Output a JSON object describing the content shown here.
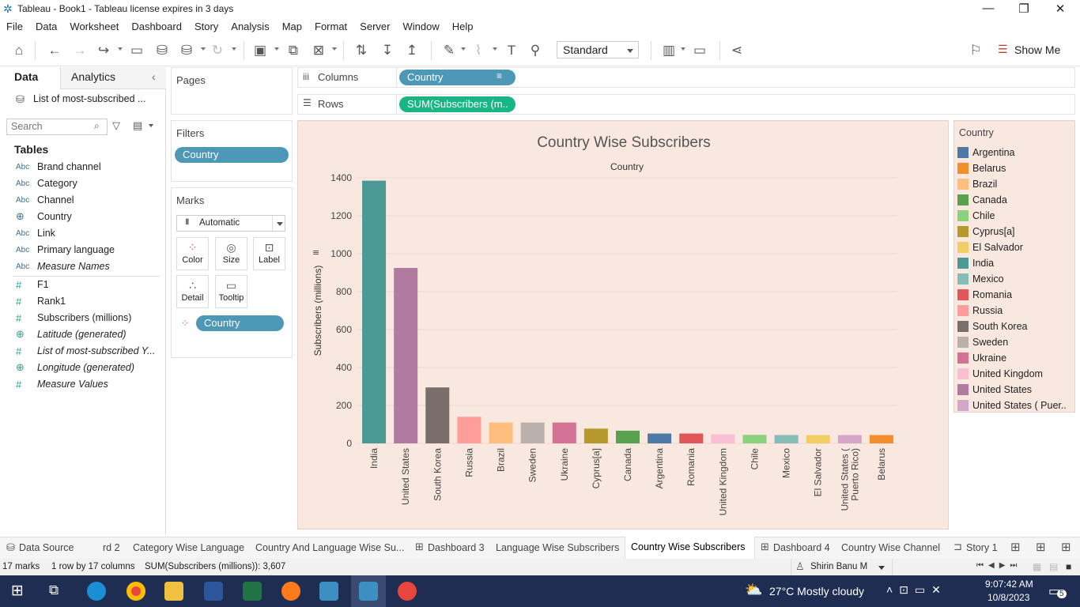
{
  "window": {
    "title": "Tableau - Book1 - Tableau license expires in 3 days"
  },
  "menu": [
    "File",
    "Data",
    "Worksheet",
    "Dashboard",
    "Story",
    "Analysis",
    "Map",
    "Format",
    "Server",
    "Window",
    "Help"
  ],
  "toolbar": {
    "fit_mode": "Standard",
    "show_me": "Show Me"
  },
  "data_pane": {
    "tab_data": "Data",
    "tab_analytics": "Analytics",
    "datasource": "List of most-subscribed ...",
    "search_placeholder": "Search",
    "tables_heading": "Tables",
    "dimensions": [
      {
        "type": "Abc",
        "name": "Brand channel"
      },
      {
        "type": "Abc",
        "name": "Category"
      },
      {
        "type": "Abc",
        "name": "Channel"
      },
      {
        "type": "globe",
        "name": "Country"
      },
      {
        "type": "Abc",
        "name": "Link"
      },
      {
        "type": "Abc",
        "name": "Primary language"
      },
      {
        "type": "Abc",
        "name": "Measure Names"
      }
    ],
    "measures": [
      {
        "type": "#",
        "name": "F1"
      },
      {
        "type": "#",
        "name": "Rank1"
      },
      {
        "type": "#",
        "name": "Subscribers (millions)"
      },
      {
        "type": "globe",
        "name": "Latitude (generated)"
      },
      {
        "type": "#",
        "name": "List of most-subscribed Y..."
      },
      {
        "type": "globe",
        "name": "Longitude (generated)"
      },
      {
        "type": "#",
        "name": "Measure Values"
      }
    ]
  },
  "cards": {
    "pages": "Pages",
    "filters": "Filters",
    "filter_pill": "Country",
    "marks": "Marks",
    "mark_type": "Automatic",
    "mark_buttons": [
      "Color",
      "Size",
      "Label",
      "Detail",
      "Tooltip"
    ],
    "color_pill": "Country"
  },
  "shelves": {
    "columns_label": "Columns",
    "columns_pill": "Country",
    "rows_label": "Rows",
    "rows_pill": "SUM(Subscribers (m.."
  },
  "chart_data": {
    "type": "bar",
    "title": "Country Wise Subscribers",
    "xlabel": "Country",
    "ylabel": "Subscribers (millions)",
    "ylim": [
      0,
      1450
    ],
    "yticks": [
      0,
      200,
      400,
      600,
      800,
      1000,
      1200,
      1400
    ],
    "categories": [
      "India",
      "United States",
      "South Korea",
      "Russia",
      "Brazil",
      "Sweden",
      "Ukraine",
      "Cyprus[a]",
      "Canada",
      "Argentina",
      "Romania",
      "United Kingdom",
      "Chile",
      "Mexico",
      "El Salvador",
      "United States ( Puerto Rico)",
      "Belarus"
    ],
    "category_labels": [
      [
        "India"
      ],
      [
        "United States"
      ],
      [
        "South Korea"
      ],
      [
        "Russia"
      ],
      [
        "Brazil"
      ],
      [
        "Sweden"
      ],
      [
        "Ukraine"
      ],
      [
        "Cyprus[a]"
      ],
      [
        "Canada"
      ],
      [
        "Argentina"
      ],
      [
        "Romania"
      ],
      [
        "United Kingdom"
      ],
      [
        "Chile"
      ],
      [
        "Mexico"
      ],
      [
        "El Salvador"
      ],
      [
        "United States (",
        "Puerto Rico)"
      ],
      [
        "Belarus"
      ]
    ],
    "values": [
      1385,
      925,
      295,
      140,
      110,
      110,
      110,
      78,
      67,
      52,
      52,
      48,
      45,
      44,
      44,
      44,
      44
    ],
    "colors": [
      "#4a9994",
      "#b07aa1",
      "#7a6e6a",
      "#ff9d9a",
      "#ffbe7d",
      "#bab0ac",
      "#d37295",
      "#b6992d",
      "#59a14f",
      "#4e79a7",
      "#e15759",
      "#fabfd2",
      "#8cd17d",
      "#86bcb6",
      "#f1ce63",
      "#d4a6c8",
      "#f28e2b"
    ]
  },
  "legend": {
    "title": "Country",
    "items": [
      {
        "name": "Argentina",
        "color": "#4e79a7"
      },
      {
        "name": "Belarus",
        "color": "#f28e2b"
      },
      {
        "name": "Brazil",
        "color": "#ffbe7d"
      },
      {
        "name": "Canada",
        "color": "#59a14f"
      },
      {
        "name": "Chile",
        "color": "#8cd17d"
      },
      {
        "name": "Cyprus[a]",
        "color": "#b6992d"
      },
      {
        "name": "El Salvador",
        "color": "#f1ce63"
      },
      {
        "name": "India",
        "color": "#4a9994"
      },
      {
        "name": "Mexico",
        "color": "#86bcb6"
      },
      {
        "name": "Romania",
        "color": "#e15759"
      },
      {
        "name": "Russia",
        "color": "#ff9d9a"
      },
      {
        "name": "South Korea",
        "color": "#79706e"
      },
      {
        "name": "Sweden",
        "color": "#bab0ac"
      },
      {
        "name": "Ukraine",
        "color": "#d37295"
      },
      {
        "name": "United Kingdom",
        "color": "#fabfd2"
      },
      {
        "name": "United States",
        "color": "#b07aa1"
      },
      {
        "name": "United States ( Puer..",
        "color": "#d4a6c8"
      }
    ]
  },
  "sheet_tabs": [
    "Data Source",
    "rd 2",
    "Category Wise Language",
    "Country And Language Wise Su...",
    "Dashboard 3",
    "Language Wise Subscribers",
    "Country Wise Subscribers",
    "Dashboard 4",
    "Country Wise Channel",
    "Story 1"
  ],
  "status": {
    "marks": "17 marks",
    "dims": "1 row by 17 columns",
    "sum": "SUM(Subscribers (millions)): 3,607",
    "user": "Shirin Banu M"
  },
  "taskbar": {
    "weather": "27°C  Mostly cloudy",
    "time": "9:07:42 AM",
    "date": "10/8/2023",
    "notif": "5"
  }
}
